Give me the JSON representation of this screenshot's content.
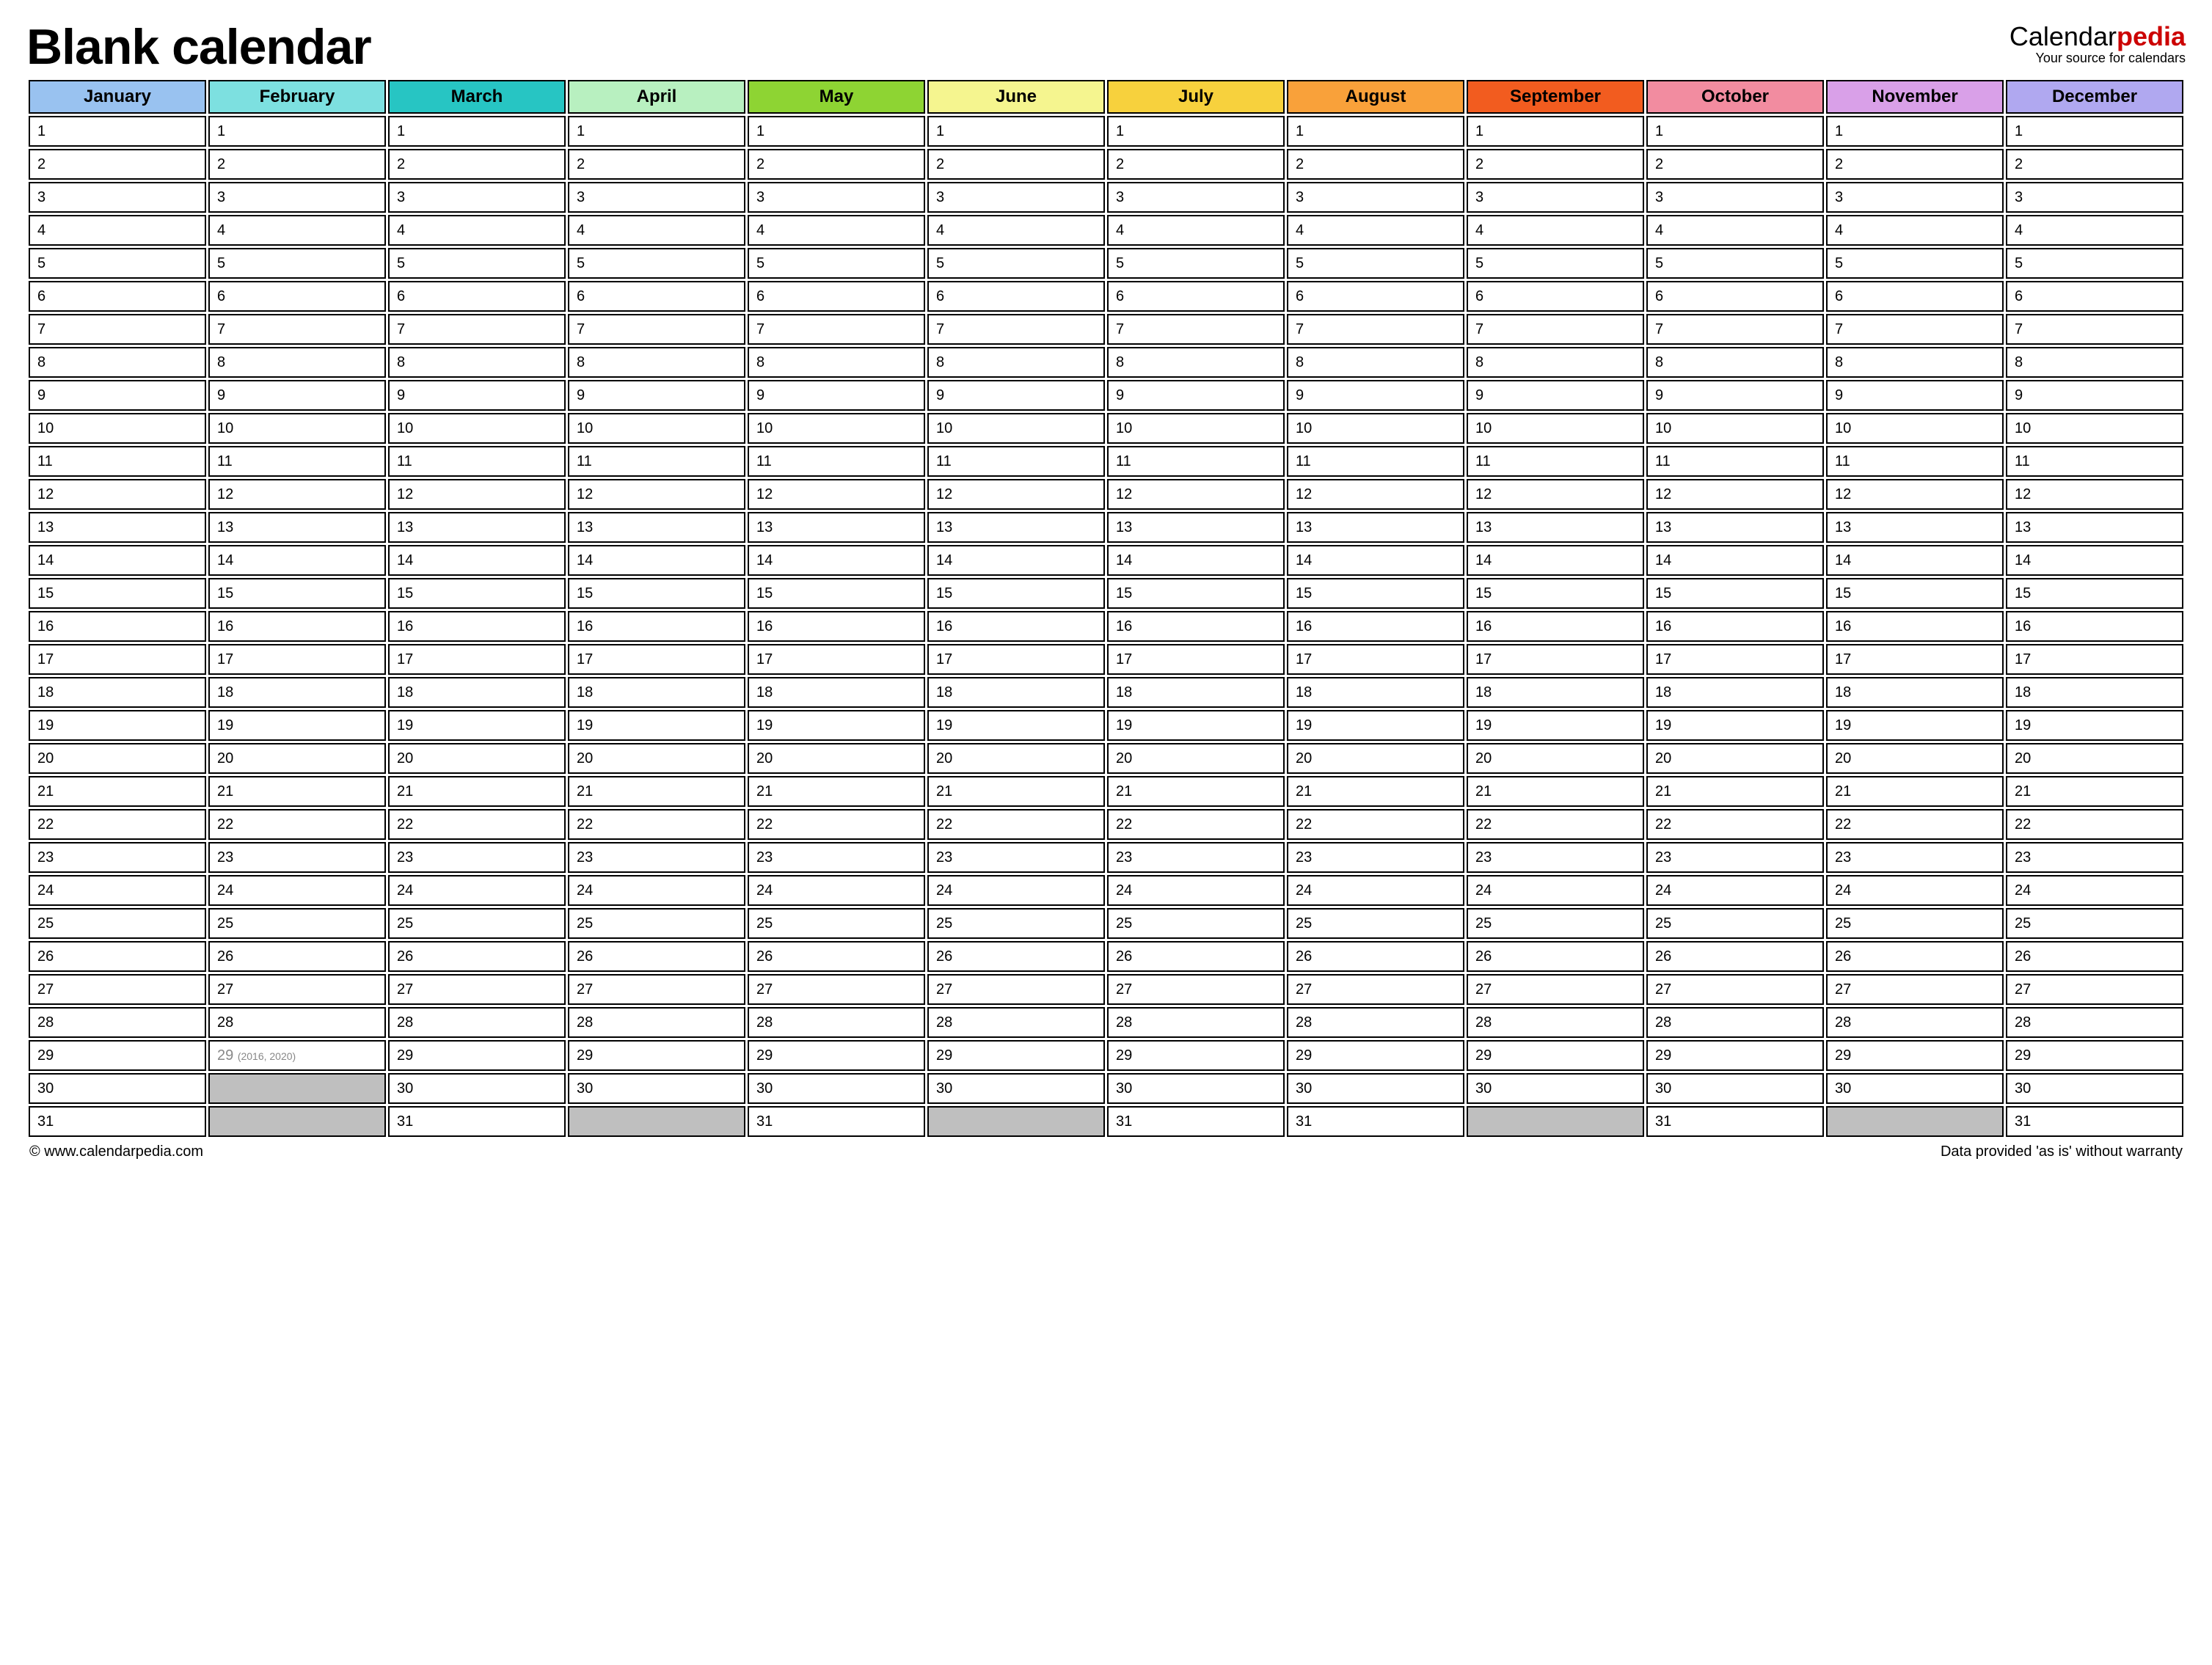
{
  "title": "Blank calendar",
  "brand": {
    "prefix": "Calendar",
    "suffix": "pedia",
    "tagline": "Your source for calendars"
  },
  "months": [
    {
      "name": "January",
      "color": "#99c2f0",
      "days": 31
    },
    {
      "name": "February",
      "color": "#7de0e0",
      "days": 29,
      "leap": {
        "row": 29,
        "note": "(2016, 2020)"
      }
    },
    {
      "name": "March",
      "color": "#27c5c3",
      "days": 31
    },
    {
      "name": "April",
      "color": "#b8f0c0",
      "days": 30
    },
    {
      "name": "May",
      "color": "#8ed433",
      "days": 31
    },
    {
      "name": "June",
      "color": "#f5f58f",
      "days": 30
    },
    {
      "name": "July",
      "color": "#f7d13d",
      "days": 31
    },
    {
      "name": "August",
      "color": "#f9a13a",
      "days": 31
    },
    {
      "name": "September",
      "color": "#f25c1f",
      "days": 30
    },
    {
      "name": "October",
      "color": "#f28ca0",
      "days": 31
    },
    {
      "name": "November",
      "color": "#d9a0e8",
      "days": 30
    },
    {
      "name": "December",
      "color": "#b0a8f0",
      "days": 31
    }
  ],
  "max_rows": 31,
  "footer": {
    "left": "© www.calendarpedia.com",
    "right": "Data provided 'as is' without warranty"
  }
}
